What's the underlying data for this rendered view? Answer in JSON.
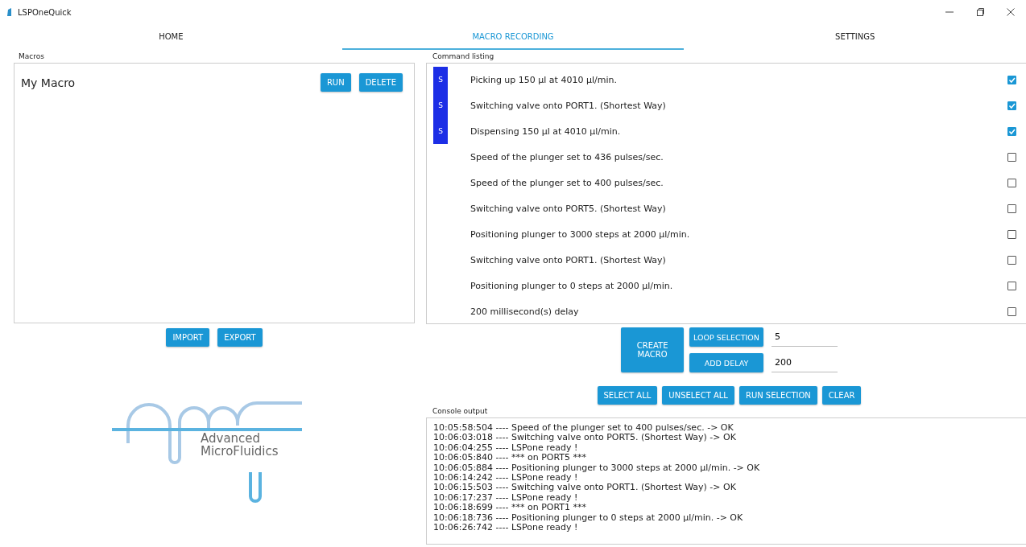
{
  "window": {
    "title": "LSPOneQuick"
  },
  "tabs": [
    {
      "label": "HOME",
      "selected": false
    },
    {
      "label": "MACRO RECORDING",
      "selected": true
    },
    {
      "label": "SETTINGS",
      "selected": false
    }
  ],
  "macros": {
    "label": "Macros",
    "items": [
      {
        "name": "My Macro",
        "buttons": [
          "RUN",
          "DELETE"
        ]
      }
    ],
    "buttons": [
      "IMPORT",
      "EXPORT"
    ]
  },
  "logo": {
    "lines": [
      "Advanced",
      "MicroFluidics"
    ]
  },
  "commands": {
    "label": "Command listing",
    "rows": [
      {
        "marker": "S",
        "text": "Picking up 150 µl at 4010 µl/min.",
        "checked": true
      },
      {
        "marker": "S",
        "text": "Switching valve onto PORT1. (Shortest Way)",
        "checked": true
      },
      {
        "marker": "S",
        "text": "Dispensing 150 µl at 4010 µl/min.",
        "checked": true
      },
      {
        "text": "Speed of the plunger set to 436 pulses/sec.",
        "checked": false
      },
      {
        "text": "Speed of the plunger set to 400 pulses/sec.",
        "checked": false
      },
      {
        "text": "Switching valve onto PORT5. (Shortest Way)",
        "checked": false
      },
      {
        "text": "Positioning plunger to 3000 steps at 2000 µl/min.",
        "checked": false
      },
      {
        "text": "Switching valve onto PORT1. (Shortest Way)",
        "checked": false
      },
      {
        "text": "Positioning plunger to 0 steps at 2000 µl/min.",
        "checked": false
      },
      {
        "text": "200 millisecond(s) delay",
        "checked": false
      }
    ]
  },
  "controls": {
    "create": "CREATE MACRO",
    "loop": {
      "button": "LOOP SELECTION",
      "value": "5"
    },
    "delay": {
      "button": "ADD DELAY",
      "value": "200"
    },
    "buttons": [
      "SELECT ALL",
      "UNSELECT ALL",
      "RUN SELECTION",
      "CLEAR"
    ]
  },
  "console": {
    "label": "Console output",
    "lines": [
      "10:05:58:504 ---- Speed of the plunger set to 400 pulses/sec. -> OK",
      "10:06:03:018 ---- Switching valve onto PORT5. (Shortest Way) -> OK",
      "10:06:04:255 ---- LSPone ready !",
      "10:06:05:840 ---- *** on PORT5 ***",
      "10:06:05:884 ---- Positioning plunger to 3000 steps at 2000 µl/min. -> OK",
      "10:06:14:242 ---- LSPone ready !",
      "10:06:15:503 ---- Switching valve onto PORT1. (Shortest Way) -> OK",
      "10:06:17:237 ---- LSPone ready !",
      "10:06:18:699 ---- *** on PORT1 ***",
      "10:06:18:736 ---- Positioning plunger to 0 steps at 2000 µl/min. -> OK",
      "10:06:26:742 ---- LSPone ready !"
    ]
  }
}
